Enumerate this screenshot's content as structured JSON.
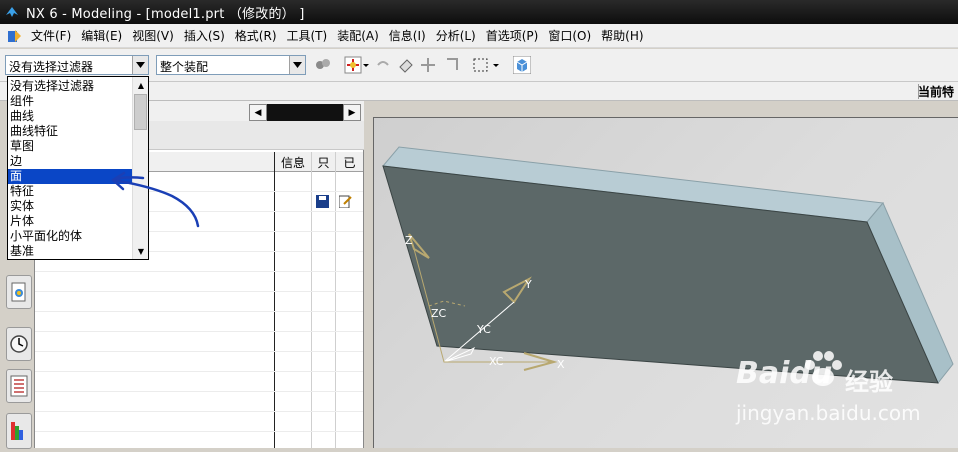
{
  "window": {
    "title": "NX 6 - Modeling - [model1.prt （修改的） ]"
  },
  "menubar": {
    "items": [
      "文件(F)",
      "编辑(E)",
      "视图(V)",
      "插入(S)",
      "格式(R)",
      "工具(T)",
      "装配(A)",
      "信息(I)",
      "分析(L)",
      "首选项(P)",
      "窗口(O)",
      "帮助(H)"
    ]
  },
  "toolbar": {
    "filter_value": "没有选择过滤器",
    "scope_value": "整个装配"
  },
  "subbar": {
    "right_label": "当前特"
  },
  "filter_dropdown": {
    "items": [
      "没有选择过滤器",
      "组件",
      "曲线",
      "曲线特征",
      "草图",
      "边",
      "面",
      "特征",
      "实体",
      "片体",
      "小平面化的体",
      "基准"
    ],
    "selected": "面"
  },
  "navigator": {
    "columns": [
      "信息",
      "只",
      "已"
    ]
  },
  "viewport": {
    "triad_labels": {
      "z": "Z",
      "y": "Y",
      "x": "X",
      "zc": "ZC",
      "yc": "YC",
      "xc": "XC"
    }
  },
  "watermark": {
    "brand": "Baidu",
    "brand_cn": "经验",
    "url": "jingyan.baidu.com"
  },
  "colors": {
    "selection": "#0a46c6",
    "annotation": "#1a3fb5",
    "block_top": "#b8ccd4",
    "block_face": "#5c6868"
  }
}
